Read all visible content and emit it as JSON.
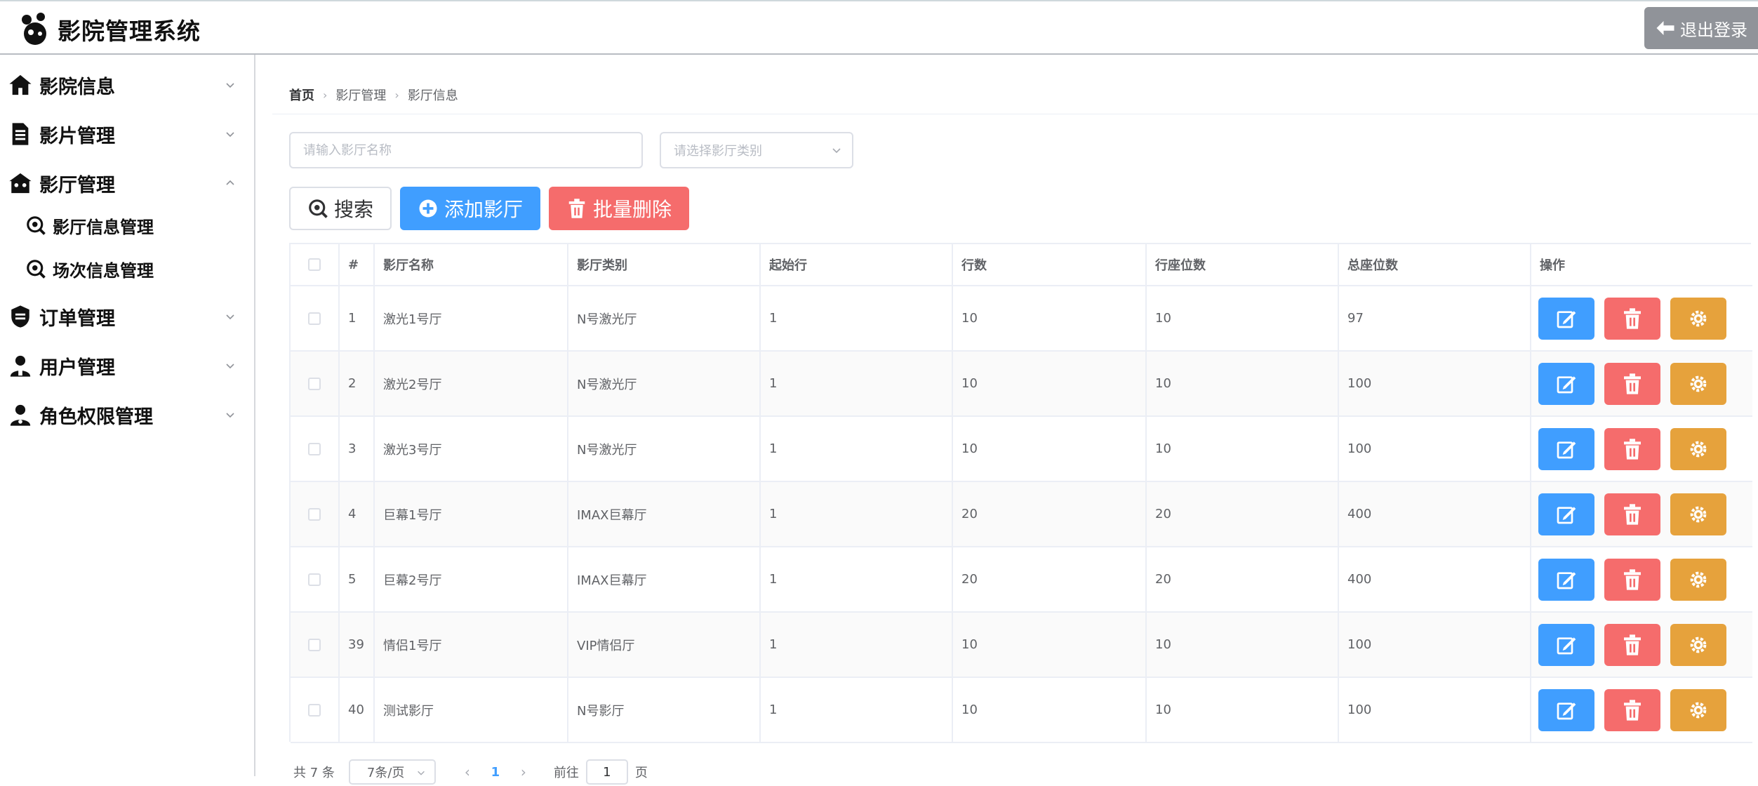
{
  "header": {
    "app_title": "影院管理系统",
    "logout_label": "退出登录"
  },
  "sidebar": {
    "items": [
      {
        "label": "影院信息",
        "icon": "home-icon",
        "expanded": false
      },
      {
        "label": "影片管理",
        "icon": "document-icon",
        "expanded": false
      },
      {
        "label": "影厅管理",
        "icon": "cinema-icon",
        "expanded": true,
        "children": [
          {
            "label": "影厅信息管理",
            "icon": "search-icon"
          },
          {
            "label": "场次信息管理",
            "icon": "search-icon"
          }
        ]
      },
      {
        "label": "订单管理",
        "icon": "shield-icon",
        "expanded": false
      },
      {
        "label": "用户管理",
        "icon": "user-icon",
        "expanded": false
      },
      {
        "label": "角色权限管理",
        "icon": "user-role-icon",
        "expanded": false
      }
    ]
  },
  "breadcrumb": [
    "首页",
    "影厅管理",
    "影厅信息"
  ],
  "filters": {
    "name_placeholder": "请输入影厅名称",
    "name_value": "",
    "type_placeholder": "请选择影厅类别"
  },
  "toolbar": {
    "search_label": "搜索",
    "add_label": "添加影厅",
    "batch_delete_label": "批量删除"
  },
  "table": {
    "columns": [
      "#",
      "影厅名称",
      "影厅类别",
      "起始行",
      "行数",
      "行座位数",
      "总座位数",
      "操作"
    ],
    "rows": [
      {
        "id": "1",
        "name": "激光1号厅",
        "type": "N号激光厅",
        "start_row": "1",
        "rows": "10",
        "seats_per_row": "10",
        "total_seats": "97"
      },
      {
        "id": "2",
        "name": "激光2号厅",
        "type": "N号激光厅",
        "start_row": "1",
        "rows": "10",
        "seats_per_row": "10",
        "total_seats": "100"
      },
      {
        "id": "3",
        "name": "激光3号厅",
        "type": "N号激光厅",
        "start_row": "1",
        "rows": "10",
        "seats_per_row": "10",
        "total_seats": "100"
      },
      {
        "id": "4",
        "name": "巨幕1号厅",
        "type": "IMAX巨幕厅",
        "start_row": "1",
        "rows": "20",
        "seats_per_row": "20",
        "total_seats": "400"
      },
      {
        "id": "5",
        "name": "巨幕2号厅",
        "type": "IMAX巨幕厅",
        "start_row": "1",
        "rows": "20",
        "seats_per_row": "20",
        "total_seats": "400"
      },
      {
        "id": "39",
        "name": "情侣1号厅",
        "type": "VIP情侣厅",
        "start_row": "1",
        "rows": "10",
        "seats_per_row": "10",
        "total_seats": "100"
      },
      {
        "id": "40",
        "name": "测试影厅",
        "type": "N号影厅",
        "start_row": "1",
        "rows": "10",
        "seats_per_row": "10",
        "total_seats": "100"
      }
    ]
  },
  "pagination": {
    "total_text": "共 7 条",
    "page_size": "7条/页",
    "current_page": "1",
    "goto_prefix": "前往",
    "goto_value": "1",
    "goto_suffix": "页"
  },
  "colors": {
    "primary": "#409eff",
    "danger": "#f56c6c",
    "warning": "#e6a23c",
    "logout": "#909399"
  }
}
